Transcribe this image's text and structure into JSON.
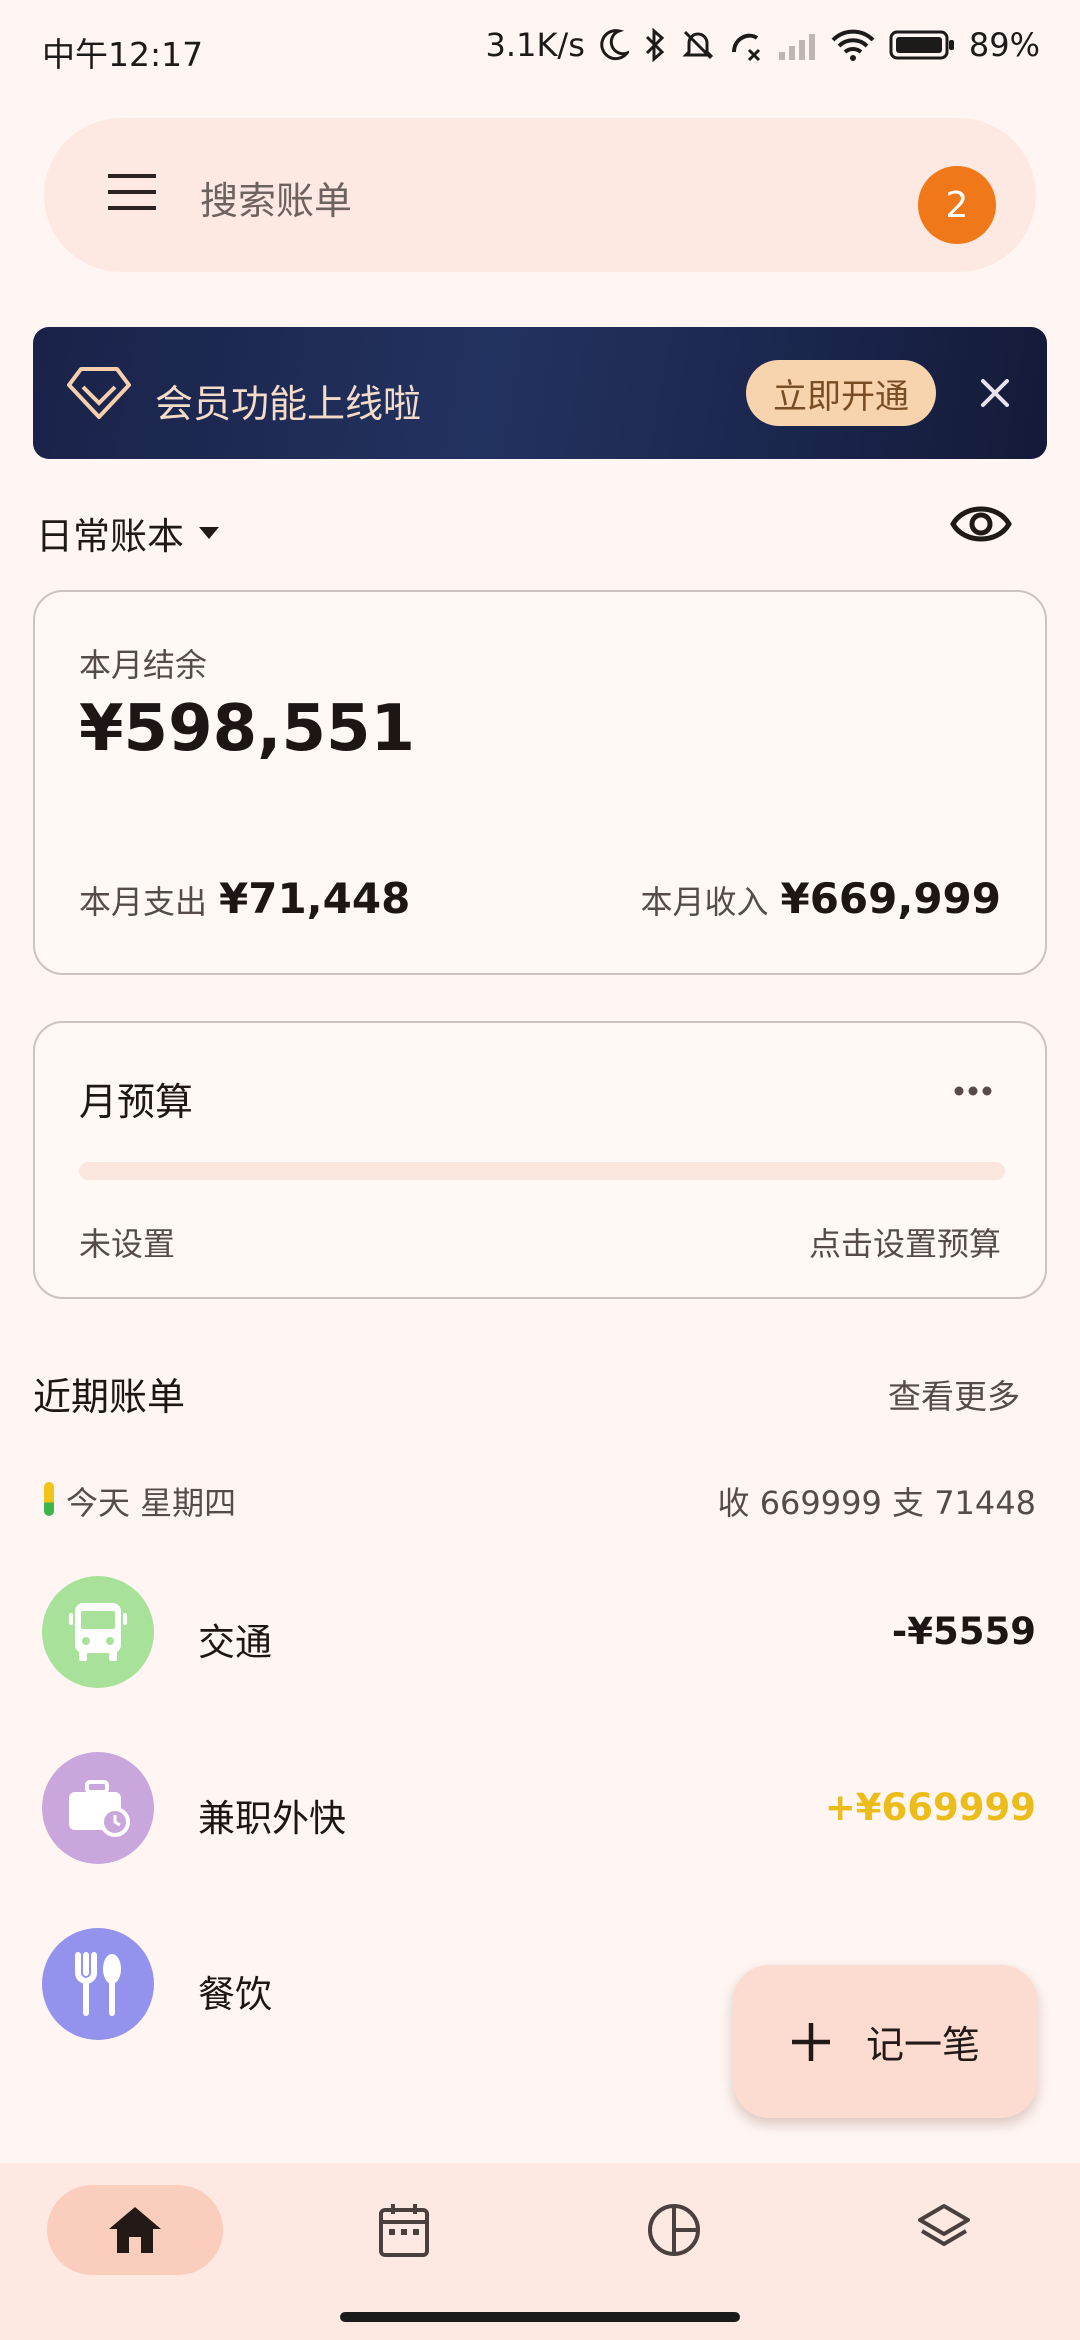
{
  "status_bar": {
    "time": "中午12:17",
    "net_speed": "3.1K/s",
    "battery": "89%"
  },
  "search": {
    "placeholder": "搜索账单",
    "badge_count": "2"
  },
  "banner": {
    "text": "会员功能上线啦",
    "button": "立即开通"
  },
  "ledger": {
    "name": "日常账本"
  },
  "balance": {
    "label": "本月结余",
    "value": "¥598,551",
    "expense_label": "本月支出",
    "expense_value": "¥71,448",
    "income_label": "本月收入",
    "income_value": "¥669,999"
  },
  "budget": {
    "title": "月预算",
    "status": "未设置",
    "action": "点击设置预算",
    "progress": 0
  },
  "recent": {
    "title": "近期账单",
    "see_more": "查看更多",
    "day_label": "今天 星期四",
    "day_sum": "收 669999  支 71448",
    "bills": [
      {
        "name": "交通",
        "amount": "-¥5559",
        "icon": "bus-icon",
        "color": "#a8e29a",
        "amount_color": "#1c1614"
      },
      {
        "name": "兼职外快",
        "amount": "+¥669999",
        "icon": "briefcase-icon",
        "color": "#c9a6dc",
        "amount_color": "#ecbc1a"
      },
      {
        "name": "餐饮",
        "amount": "",
        "icon": "cutlery-icon",
        "color": "#9393ee",
        "amount_color": "#1c1614"
      }
    ]
  },
  "fab": {
    "label": "记一笔"
  },
  "nav": {
    "items": [
      "home-icon",
      "calendar-icon",
      "chart-icon",
      "layers-icon"
    ],
    "active": 0
  },
  "colors": {
    "accent": "#f07818",
    "background": "#fff6f3",
    "income": "#ecbc1a"
  }
}
